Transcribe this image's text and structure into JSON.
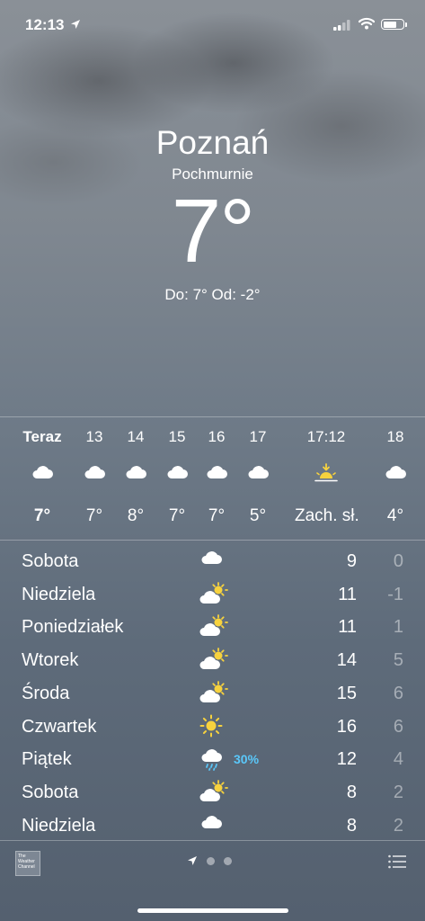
{
  "status_bar": {
    "time": "12:13"
  },
  "header": {
    "city": "Poznań",
    "condition": "Pochmurnie",
    "temperature": "7°",
    "hi_lo": "Do: 7° Od: -2°"
  },
  "hourly": [
    {
      "label": "Teraz",
      "icon": "cloud-icon",
      "temp": "7°"
    },
    {
      "label": "13",
      "icon": "cloud-icon",
      "temp": "7°"
    },
    {
      "label": "14",
      "icon": "cloud-icon",
      "temp": "8°"
    },
    {
      "label": "15",
      "icon": "cloud-icon",
      "temp": "7°"
    },
    {
      "label": "16",
      "icon": "cloud-icon",
      "temp": "7°"
    },
    {
      "label": "17",
      "icon": "cloud-icon",
      "temp": "5°"
    },
    {
      "label": "17:12",
      "icon": "sunset-icon",
      "temp": "Zach. sł."
    },
    {
      "label": "18",
      "icon": "cloud-icon",
      "temp": "4°"
    }
  ],
  "daily": [
    {
      "day": "Sobota",
      "icon": "cloud-icon",
      "precip": "",
      "high": "9",
      "low": "0"
    },
    {
      "day": "Niedziela",
      "icon": "partly-cloudy-icon",
      "precip": "",
      "high": "11",
      "low": "-1"
    },
    {
      "day": "Poniedziałek",
      "icon": "partly-cloudy-icon",
      "precip": "",
      "high": "11",
      "low": "1"
    },
    {
      "day": "Wtorek",
      "icon": "partly-cloudy-icon",
      "precip": "",
      "high": "14",
      "low": "5"
    },
    {
      "day": "Środa",
      "icon": "partly-cloudy-icon",
      "precip": "",
      "high": "15",
      "low": "6"
    },
    {
      "day": "Czwartek",
      "icon": "sun-icon",
      "precip": "",
      "high": "16",
      "low": "6"
    },
    {
      "day": "Piątek",
      "icon": "rain-icon",
      "precip": "30%",
      "high": "12",
      "low": "4"
    },
    {
      "day": "Sobota",
      "icon": "partly-cloudy-icon",
      "precip": "",
      "high": "8",
      "low": "2"
    },
    {
      "day": "Niedziela",
      "icon": "cloud-icon",
      "precip": "",
      "high": "8",
      "low": "2"
    }
  ],
  "footer": {
    "provider_logo": "The Weather Channel"
  },
  "colors": {
    "precip_blue": "#5ac8fa",
    "sun_yellow": "#f7d23e"
  }
}
